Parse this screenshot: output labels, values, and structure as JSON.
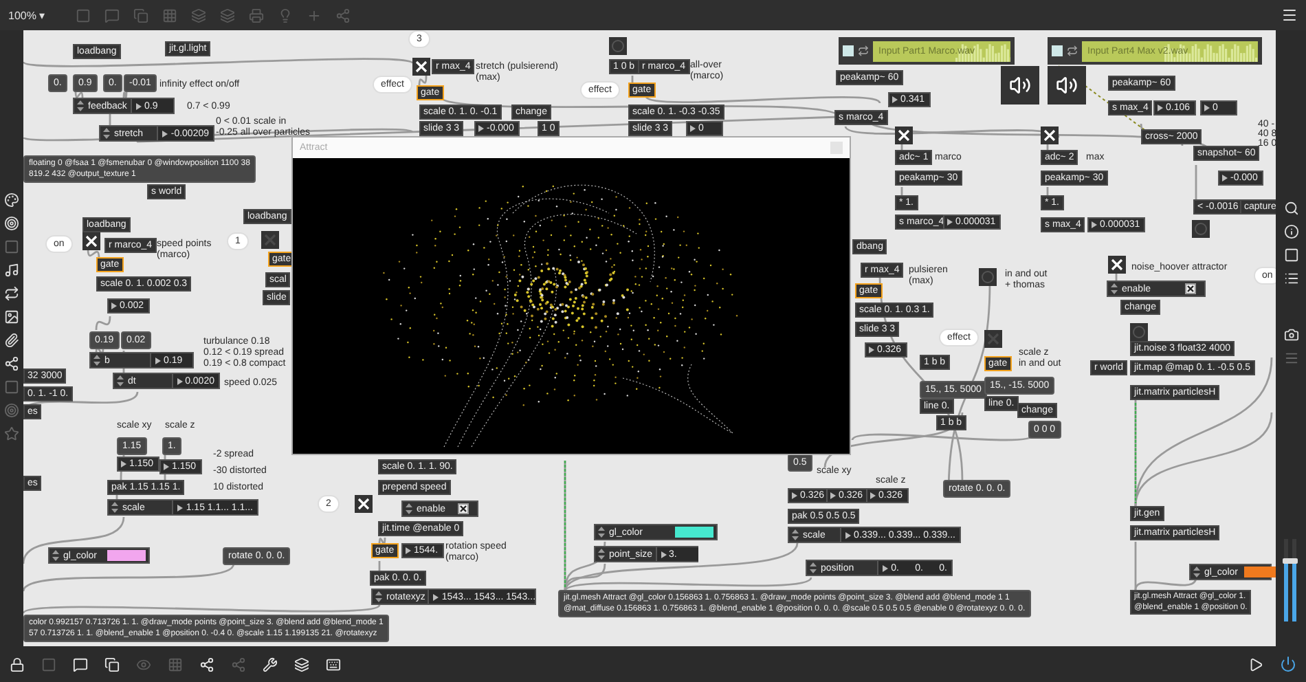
{
  "toolbar": {
    "zoom": "100% ▾"
  },
  "video_window": {
    "title": "Attract"
  },
  "playlists": [
    {
      "file": "Input Part1 Marco.wav"
    },
    {
      "file": "Input Part4 Max v2.wav"
    }
  ],
  "objects": [
    {
      "kind": "obj",
      "text": "loadbang"
    },
    {
      "kind": "obj",
      "text": "jit.gl.light"
    },
    {
      "kind": "msg",
      "text": "0."
    },
    {
      "kind": "msg",
      "text": "0.9"
    },
    {
      "kind": "msg",
      "text": "0."
    },
    {
      "kind": "msg",
      "text": "-0.01"
    },
    {
      "kind": "comment",
      "text": "infinity effect on/off"
    },
    {
      "kind": "attrui",
      "label": "feedback",
      "value": "0.9"
    },
    {
      "kind": "comment",
      "text": "0.7 < 0.99"
    },
    {
      "kind": "attrui",
      "label": "stretch",
      "value": "-0.00209"
    },
    {
      "kind": "comment",
      "text": "0 < 0.01 scale in"
    },
    {
      "kind": "comment",
      "text": "-0.25 all over particles"
    },
    {
      "kind": "bubble",
      "text": "3"
    },
    {
      "kind": "toggle",
      "checked": true
    },
    {
      "kind": "obj",
      "text": "r max_4"
    },
    {
      "kind": "comment",
      "text": "stretch (pulsierend)"
    },
    {
      "kind": "comment",
      "text": "(max)"
    },
    {
      "kind": "bubble",
      "text": "effect"
    },
    {
      "kind": "gate",
      "text": "gate"
    },
    {
      "kind": "obj",
      "text": "scale 0. 1. 0. -0.1"
    },
    {
      "kind": "obj",
      "text": "slide 3 3"
    },
    {
      "kind": "num",
      "text": "-0.000"
    },
    {
      "kind": "obj",
      "text": "change"
    },
    {
      "kind": "obj",
      "text": "1 0"
    },
    {
      "kind": "bang"
    },
    {
      "kind": "obj",
      "text": "1 0 b"
    },
    {
      "kind": "obj",
      "text": "r marco_4"
    },
    {
      "kind": "comment",
      "text": "all-over"
    },
    {
      "kind": "comment",
      "text": "(marco)"
    },
    {
      "kind": "bubble",
      "text": "effect"
    },
    {
      "kind": "gate",
      "text": "gate"
    },
    {
      "kind": "obj",
      "text": "scale 0. 1. -0.3 -0.35"
    },
    {
      "kind": "obj",
      "text": "slide 3 3"
    },
    {
      "kind": "num",
      "text": "0"
    },
    {
      "kind": "msg",
      "text": "floating 0 @fsaa 1 @fsmenubar 0 @windowposition 1100 38\n819.2 432 @output_texture 1"
    },
    {
      "kind": "obj",
      "text": "s world"
    },
    {
      "kind": "obj",
      "text": "loadbang"
    },
    {
      "kind": "bubble",
      "text": "on"
    },
    {
      "kind": "toggle",
      "checked": true
    },
    {
      "kind": "obj",
      "text": "r marco_4"
    },
    {
      "kind": "comment",
      "text": "speed points"
    },
    {
      "kind": "comment",
      "text": "(marco)"
    },
    {
      "kind": "gate",
      "text": "gate"
    },
    {
      "kind": "obj",
      "text": "scale 0. 1. 0.002 0.3"
    },
    {
      "kind": "num",
      "text": "0.002"
    },
    {
      "kind": "msg",
      "text": "0.19"
    },
    {
      "kind": "msg",
      "text": "0.02"
    },
    {
      "kind": "attrui",
      "label": "b",
      "value": "0.19"
    },
    {
      "kind": "attrui",
      "label": "dt",
      "value": "0.0020"
    },
    {
      "kind": "comment",
      "text": "turbulance 0.18"
    },
    {
      "kind": "comment",
      "text": "0.12 < 0.19 spread"
    },
    {
      "kind": "comment",
      "text": "0.19 < 0.8 compact"
    },
    {
      "kind": "comment",
      "text": "speed 0.025"
    },
    {
      "kind": "obj",
      "text": "32 3000"
    },
    {
      "kind": "obj",
      "text": "0. 1. -1 0."
    },
    {
      "kind": "obj",
      "text": "es"
    },
    {
      "kind": "obj",
      "text": "es"
    },
    {
      "kind": "comment",
      "text": "scale xy"
    },
    {
      "kind": "comment",
      "text": "scale z"
    },
    {
      "kind": "msg",
      "text": "1.15"
    },
    {
      "kind": "msg",
      "text": "1."
    },
    {
      "kind": "num",
      "text": "1.150"
    },
    {
      "kind": "num",
      "text": "1.150"
    },
    {
      "kind": "comment",
      "text": "-2 spread"
    },
    {
      "kind": "comment",
      "text": "-30 distorted"
    },
    {
      "kind": "obj",
      "text": "pak 1.15 1.15 1."
    },
    {
      "kind": "comment",
      "text": "10 distorted"
    },
    {
      "kind": "attrui",
      "label": "scale",
      "value": "1.15 1.1... 1.1..."
    },
    {
      "kind": "attrui",
      "label": "gl_color",
      "color": "#f2a6ee"
    },
    {
      "kind": "msg",
      "text": "rotate 0. 0. 0."
    },
    {
      "kind": "msg",
      "text": "color 0.992157 0.713726 1. 1. @draw_mode points @point_size 3. @blend add @blend_mode 1\n57 0.713726 1. 1. @blend_enable 1 @position 0. -0.4 0. @scale 1.15 1.199135 21. @rotatexyz"
    },
    {
      "kind": "bubble",
      "text": "2"
    },
    {
      "kind": "toggle",
      "checked": true
    },
    {
      "kind": "obj",
      "text": "scale 0. 1. 1. 90."
    },
    {
      "kind": "obj",
      "text": "prepend speed"
    },
    {
      "kind": "attrui",
      "label": "enable",
      "checked": true
    },
    {
      "kind": "obj",
      "text": "jit.time @enable 0"
    },
    {
      "kind": "gate",
      "text": "gate"
    },
    {
      "kind": "num",
      "text": "1544."
    },
    {
      "kind": "comment",
      "text": "rotation speed"
    },
    {
      "kind": "comment",
      "text": "(marco)"
    },
    {
      "kind": "obj",
      "text": "pak 0. 0. 0."
    },
    {
      "kind": "attrui",
      "label": "rotatexyz",
      "value": "1543... 1543... 1543..."
    },
    {
      "kind": "attrui",
      "label": "gl_color",
      "color": "#46e8cf"
    },
    {
      "kind": "attrui",
      "label": "point_size",
      "value": "3."
    },
    {
      "kind": "msg",
      "text": "jit.gl.mesh Attract @gl_color 0.156863 1. 0.756863 1. @draw_mode points @point_size 3. @blend add @blend_mode 1 1\n@mat_diffuse 0.156863 1. 0.756863 1. @blend_enable 1 @position 0. 0. 0. @scale 0.5 0.5 0.5 @enable 0 @rotatexyz 0. 0. 0."
    },
    {
      "kind": "msg",
      "text": "0.5"
    },
    {
      "kind": "comment",
      "text": "scale xy"
    },
    {
      "kind": "comment",
      "text": "scale z"
    },
    {
      "kind": "num",
      "text": "0.326"
    },
    {
      "kind": "num",
      "text": "0.326"
    },
    {
      "kind": "num",
      "text": "0.326"
    },
    {
      "kind": "obj",
      "text": "pak 0.5 0.5 0.5"
    },
    {
      "kind": "attrui",
      "label": "scale",
      "value": "0.339... 0.339... 0.339..."
    },
    {
      "kind": "attrui",
      "label": "position",
      "value": "0.      0.      0."
    },
    {
      "kind": "bubble",
      "text": "effect"
    },
    {
      "kind": "toggle",
      "checked": false
    },
    {
      "kind": "obj",
      "text": "1 b b"
    },
    {
      "kind": "gate",
      "text": "gate"
    },
    {
      "kind": "comment",
      "text": "scale z"
    },
    {
      "kind": "comment",
      "text": "in and out"
    },
    {
      "kind": "msg",
      "text": "15., 15. 5000"
    },
    {
      "kind": "msg",
      "text": "15., -15. 5000"
    },
    {
      "kind": "obj",
      "text": "line 0."
    },
    {
      "kind": "obj",
      "text": "line 0."
    },
    {
      "kind": "obj",
      "text": "1 b b"
    },
    {
      "kind": "obj",
      "text": "change"
    },
    {
      "kind": "msg",
      "text": "0 0 0"
    },
    {
      "kind": "msg",
      "text": "rotate 0. 0. 0."
    },
    {
      "kind": "obj",
      "text": "jit.noise 3 float32 4000"
    },
    {
      "kind": "obj",
      "text": "r world"
    },
    {
      "kind": "obj",
      "text": "jit.map @map 0. 1. -0.5 0.5"
    },
    {
      "kind": "obj",
      "text": "jit.matrix particlesH"
    },
    {
      "kind": "obj",
      "text": "jit.gen"
    },
    {
      "kind": "obj",
      "text": "jit.matrix particlesH"
    },
    {
      "kind": "attrui",
      "label": "gl_color",
      "color": "#f07a1e"
    },
    {
      "kind": "obj",
      "text": "jit.gl.mesh Attract @gl_color 1.\n@blend_enable 1 @position 0."
    },
    {
      "kind": "obj",
      "text": "peakamp~ 60"
    },
    {
      "kind": "num",
      "text": "0.341"
    },
    {
      "kind": "obj",
      "text": "s marco_4"
    },
    {
      "kind": "obj",
      "text": "peakamp~ 60"
    },
    {
      "kind": "obj",
      "text": "s max_4"
    },
    {
      "kind": "num",
      "text": "0.106"
    },
    {
      "kind": "num",
      "text": "0"
    },
    {
      "kind": "comment",
      "text": "40 -"
    },
    {
      "kind": "comment",
      "text": "40 8"
    },
    {
      "kind": "comment",
      "text": "16 0"
    },
    {
      "kind": "obj",
      "text": "cross~ 2000"
    },
    {
      "kind": "obj",
      "text": "snapshot~ 60"
    },
    {
      "kind": "num",
      "text": "-0.000"
    },
    {
      "kind": "obj",
      "text": "< -0.0016"
    },
    {
      "kind": "obj",
      "text": "capture"
    },
    {
      "kind": "bang"
    },
    {
      "kind": "toggle",
      "checked": true
    },
    {
      "kind": "obj",
      "text": "adc~ 1"
    },
    {
      "kind": "comment",
      "text": "marco"
    },
    {
      "kind": "obj",
      "text": "peakamp~ 30"
    },
    {
      "kind": "obj",
      "text": "* 1."
    },
    {
      "kind": "obj",
      "text": "s marco_4"
    },
    {
      "kind": "num",
      "text": "0.000031"
    },
    {
      "kind": "toggle",
      "checked": true
    },
    {
      "kind": "obj",
      "text": "adc~ 2"
    },
    {
      "kind": "comment",
      "text": "max"
    },
    {
      "kind": "obj",
      "text": "peakamp~ 30"
    },
    {
      "kind": "obj",
      "text": "* 1."
    },
    {
      "kind": "obj",
      "text": "s max_4"
    },
    {
      "kind": "num",
      "text": "0.000031"
    },
    {
      "kind": "obj",
      "text": "dbang"
    },
    {
      "kind": "obj",
      "text": "r max_4"
    },
    {
      "kind": "comment",
      "text": "pulsieren"
    },
    {
      "kind": "comment",
      "text": "(max)"
    },
    {
      "kind": "gate",
      "text": "gate"
    },
    {
      "kind": "obj",
      "text": "scale 0. 1. 0.3 1."
    },
    {
      "kind": "obj",
      "text": "slide 3 3"
    },
    {
      "kind": "num",
      "text": "0.326"
    },
    {
      "kind": "bang"
    },
    {
      "kind": "comment",
      "text": "in and out"
    },
    {
      "kind": "comment",
      "text": "+ thomas"
    },
    {
      "kind": "toggle",
      "checked": true
    },
    {
      "kind": "comment",
      "text": "noise_hoover attractor"
    },
    {
      "kind": "attrui",
      "label": "enable",
      "checked": true
    },
    {
      "kind": "obj",
      "text": "change"
    },
    {
      "kind": "bang"
    },
    {
      "kind": "bubble",
      "text": "on"
    },
    {
      "kind": "bubble",
      "text": "1"
    },
    {
      "kind": "toggle",
      "checked": false
    },
    {
      "kind": "obj",
      "text": "loadbang"
    },
    {
      "kind": "gate",
      "text": "gate"
    },
    {
      "kind": "obj",
      "text": "scal"
    },
    {
      "kind": "obj",
      "text": "slide"
    }
  ]
}
